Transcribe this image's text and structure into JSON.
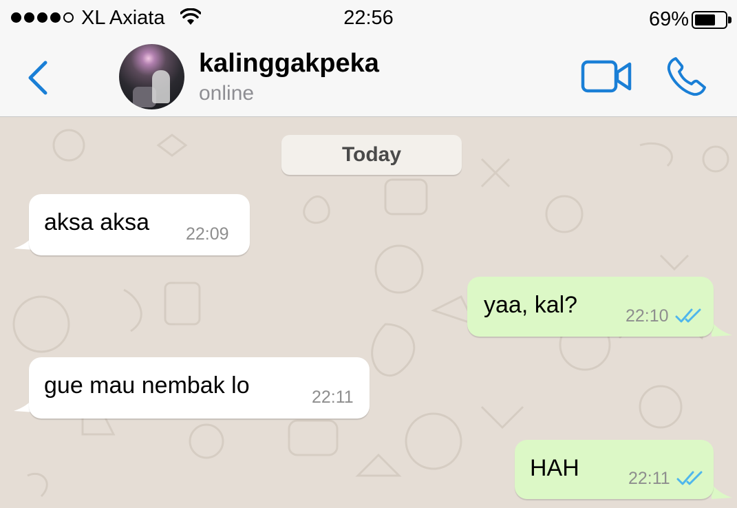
{
  "status_bar": {
    "carrier": "XL Axiata",
    "time": "22:56",
    "battery_percent": "69%",
    "battery_level": 0.69,
    "signal_bars_filled": 4,
    "signal_bars_total": 5
  },
  "header": {
    "contact_name": "kalinggakpeka",
    "contact_status": "online",
    "accent_color": "#1a7fd6",
    "icons": [
      "chevron-left-icon",
      "video-call-icon",
      "phone-icon"
    ]
  },
  "chat": {
    "date_label": "Today",
    "messages": [
      {
        "direction": "incoming",
        "text": "aksa aksa",
        "time": "22:09"
      },
      {
        "direction": "outgoing",
        "text": "yaa, kal?",
        "time": "22:10",
        "status": "read"
      },
      {
        "direction": "incoming",
        "text": "gue mau nembak lo",
        "time": "22:11"
      },
      {
        "direction": "outgoing",
        "text": "HAH",
        "time": "22:11",
        "status": "read"
      }
    ],
    "incoming_bubble_color": "#ffffff",
    "outgoing_bubble_color": "#dcf8c6",
    "read_tick_color": "#4fb6ec"
  }
}
